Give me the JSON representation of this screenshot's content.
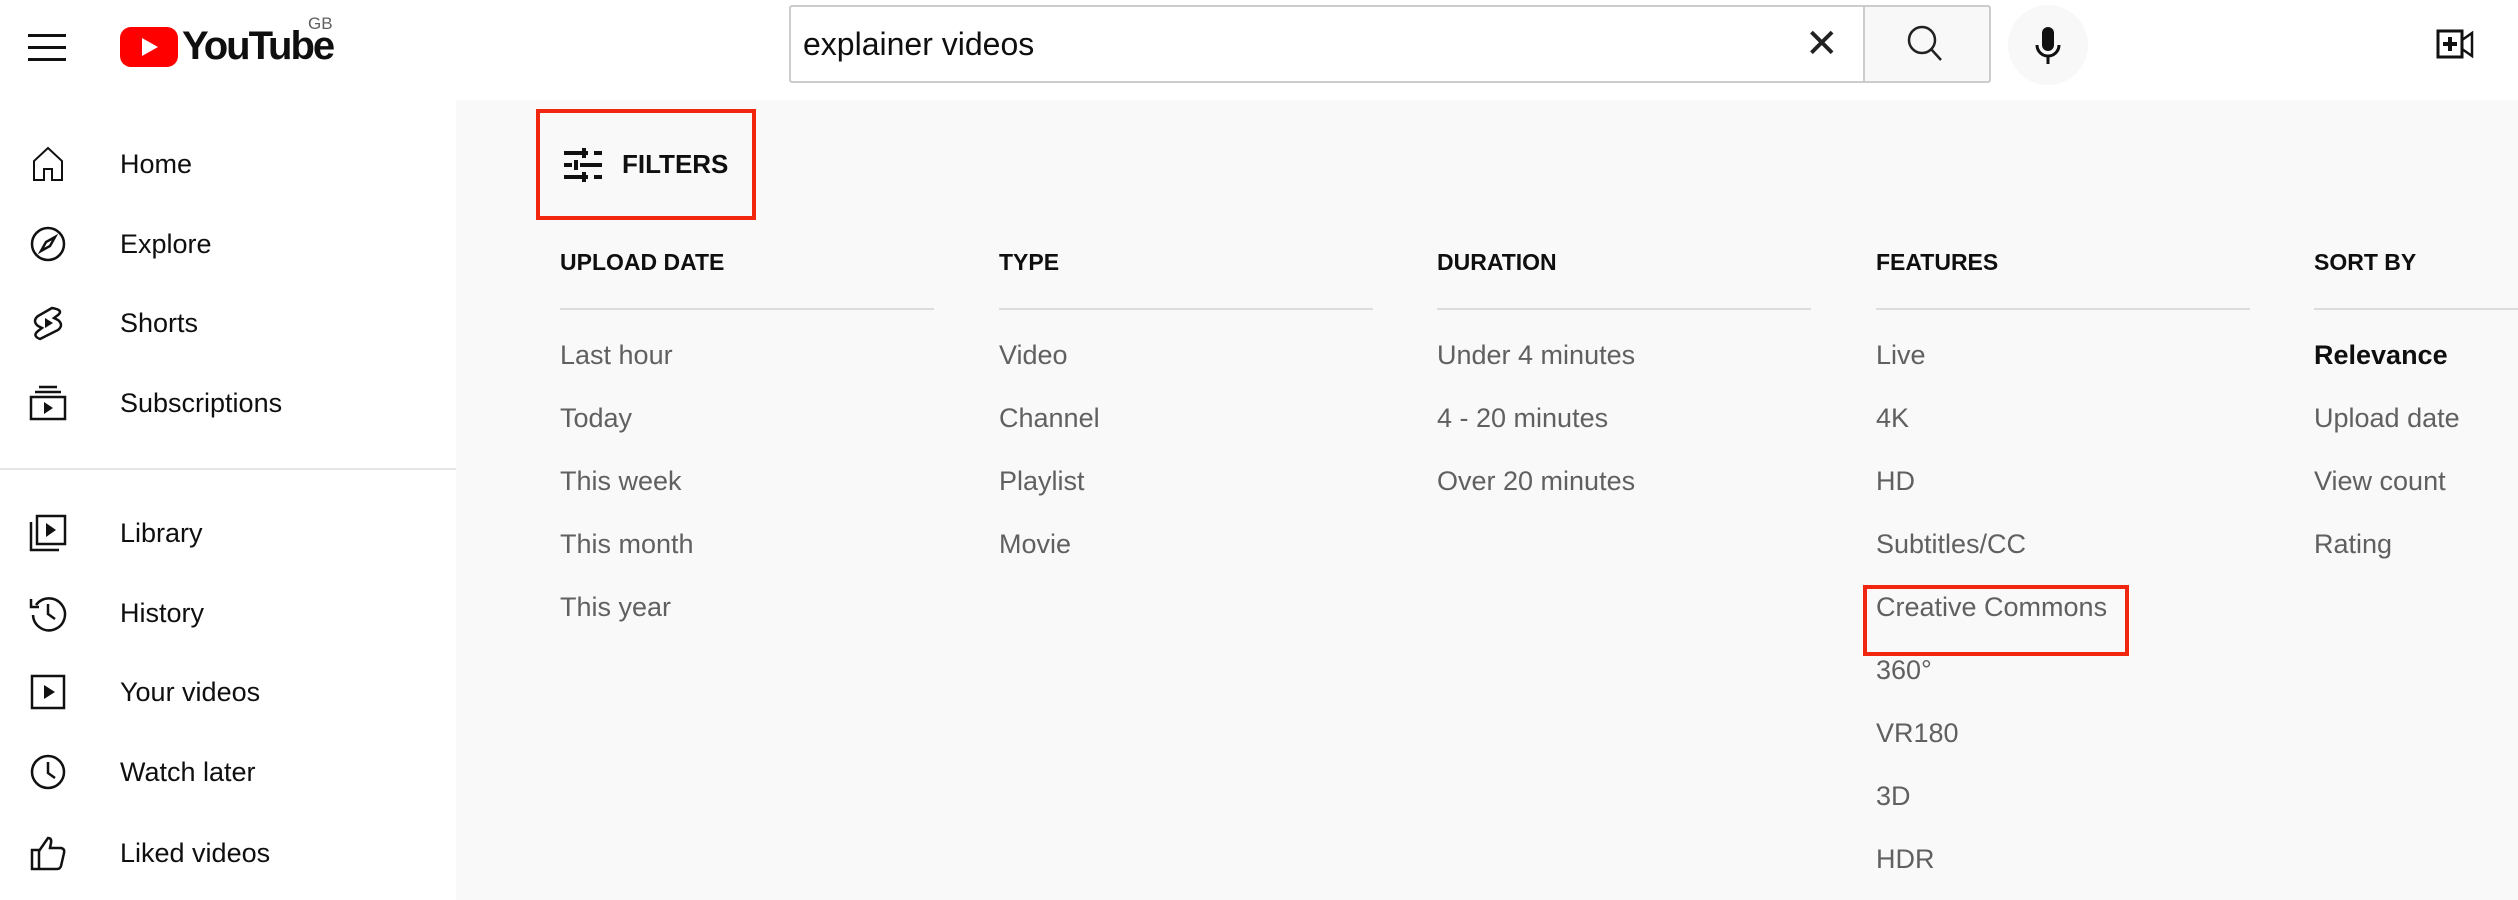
{
  "header": {
    "logo": "YouTube",
    "region": "GB",
    "search_value": "explainer videos",
    "icons": [
      "menu-icon",
      "clear-icon",
      "search-icon",
      "mic-icon",
      "create-video-icon"
    ]
  },
  "sidebar": {
    "items": [
      {
        "label": "Home",
        "icon": "home-icon"
      },
      {
        "label": "Explore",
        "icon": "compass-icon"
      },
      {
        "label": "Shorts",
        "icon": "shorts-icon"
      },
      {
        "label": "Subscriptions",
        "icon": "subscriptions-icon"
      },
      {
        "label": "Library",
        "icon": "library-icon"
      },
      {
        "label": "History",
        "icon": "history-icon"
      },
      {
        "label": "Your videos",
        "icon": "play-icon"
      },
      {
        "label": "Watch later",
        "icon": "clock-icon"
      },
      {
        "label": "Liked videos",
        "icon": "thumb-up-icon"
      }
    ]
  },
  "filters": {
    "label": "FILTERS",
    "highlight_color": "#f0260f",
    "columns": [
      {
        "title": "UPLOAD DATE",
        "items": [
          "Last hour",
          "Today",
          "This week",
          "This month",
          "This year"
        ]
      },
      {
        "title": "TYPE",
        "items": [
          "Video",
          "Channel",
          "Playlist",
          "Movie"
        ]
      },
      {
        "title": "DURATION",
        "items": [
          "Under 4 minutes",
          "4 - 20 minutes",
          "Over 20 minutes"
        ]
      },
      {
        "title": "FEATURES",
        "items": [
          "Live",
          "4K",
          "HD",
          "Subtitles/CC",
          "Creative Commons",
          "360°",
          "VR180",
          "3D",
          "HDR"
        ]
      },
      {
        "title": "SORT BY",
        "items": [
          "Relevance",
          "Upload date",
          "View count",
          "Rating"
        ],
        "selected": "Relevance"
      }
    ]
  }
}
